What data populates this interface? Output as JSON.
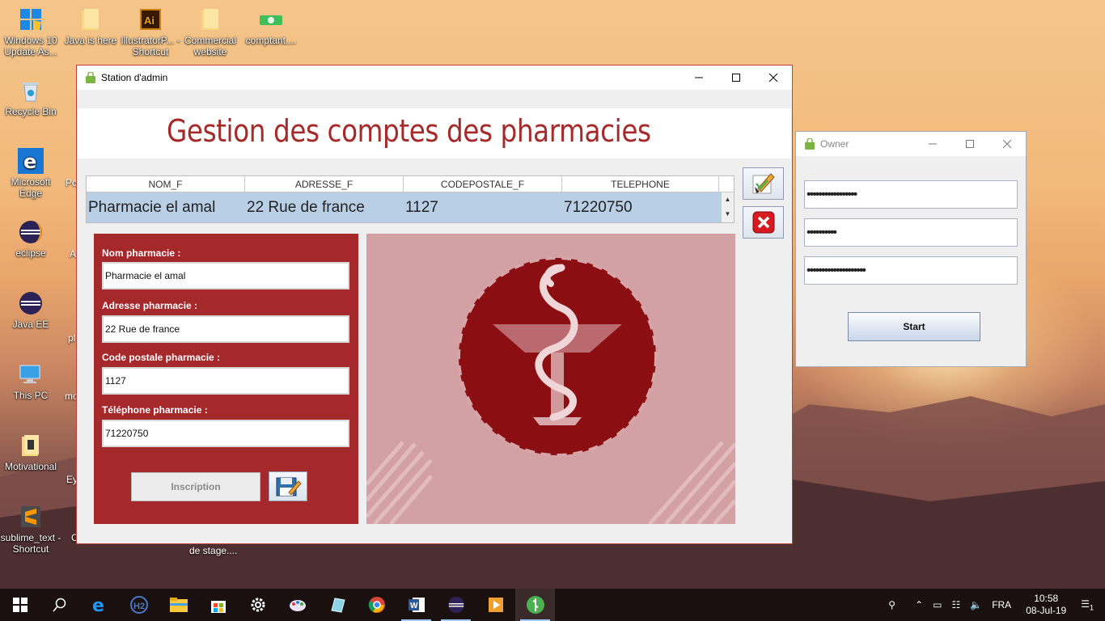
{
  "desktop": {
    "icons": [
      {
        "label": "Windows 10 Update As...",
        "icon": "windows-update-icon"
      },
      {
        "label": "Java is here",
        "icon": "folder-icon"
      },
      {
        "label": "IllustratorP... - Shortcut",
        "icon": "illustrator-icon"
      },
      {
        "label": "Commercial website",
        "icon": "folder-icon"
      },
      {
        "label": "comptant....",
        "icon": "green-app-icon"
      },
      {
        "label": "Recycle Bin",
        "icon": "recycle-bin-icon"
      },
      {
        "label": "Microsoft Edge",
        "icon": "edge-icon"
      },
      {
        "label": "eclipse",
        "icon": "eclipse-icon"
      },
      {
        "label": "Java EE",
        "icon": "eclipse-icon"
      },
      {
        "label": "This PC",
        "icon": "computer-icon"
      },
      {
        "label": "Motivational",
        "icon": "folder-icon"
      },
      {
        "label": "sublime_text - Shortcut",
        "icon": "sublime-icon"
      }
    ],
    "partial_labels": [
      "mo",
      "Ey",
      "de stage....",
      "Po",
      "A",
      "pl",
      "C"
    ]
  },
  "main_window": {
    "title": "Station d'admin",
    "heading": "Gestion des comptes des pharmacies",
    "table": {
      "columns": [
        "NOM_F",
        "ADRESSE_F",
        "CODEPOSTALE_F",
        "TELEPHONE"
      ],
      "rows": [
        [
          "Pharmacie el amal",
          "22 Rue de france",
          "1127",
          "71220750"
        ]
      ]
    },
    "form": {
      "name_label": "Nom pharmacie :",
      "name_value": "Pharmacie el amal",
      "address_label": "Adresse pharmacie :",
      "address_value": "22 Rue de france",
      "postal_label": "Code postale pharmacie :",
      "postal_value": "1127",
      "phone_label": "Téléphone pharmacie :",
      "phone_value": "71220750",
      "submit_label": "Inscription"
    }
  },
  "owner_window": {
    "title": "Owner",
    "field1": "•••••••••••••••••",
    "field2": "••••••••••",
    "field3": "••••••••••••••••••••",
    "start_label": "Start"
  },
  "taskbar": {
    "language": "FRA",
    "time": "10:58",
    "date": "08-Jul-19",
    "notification_count": "1"
  },
  "colors": {
    "accent": "#a5282b",
    "selection": "#b8cfe6",
    "taskbar": "#1a1010"
  }
}
